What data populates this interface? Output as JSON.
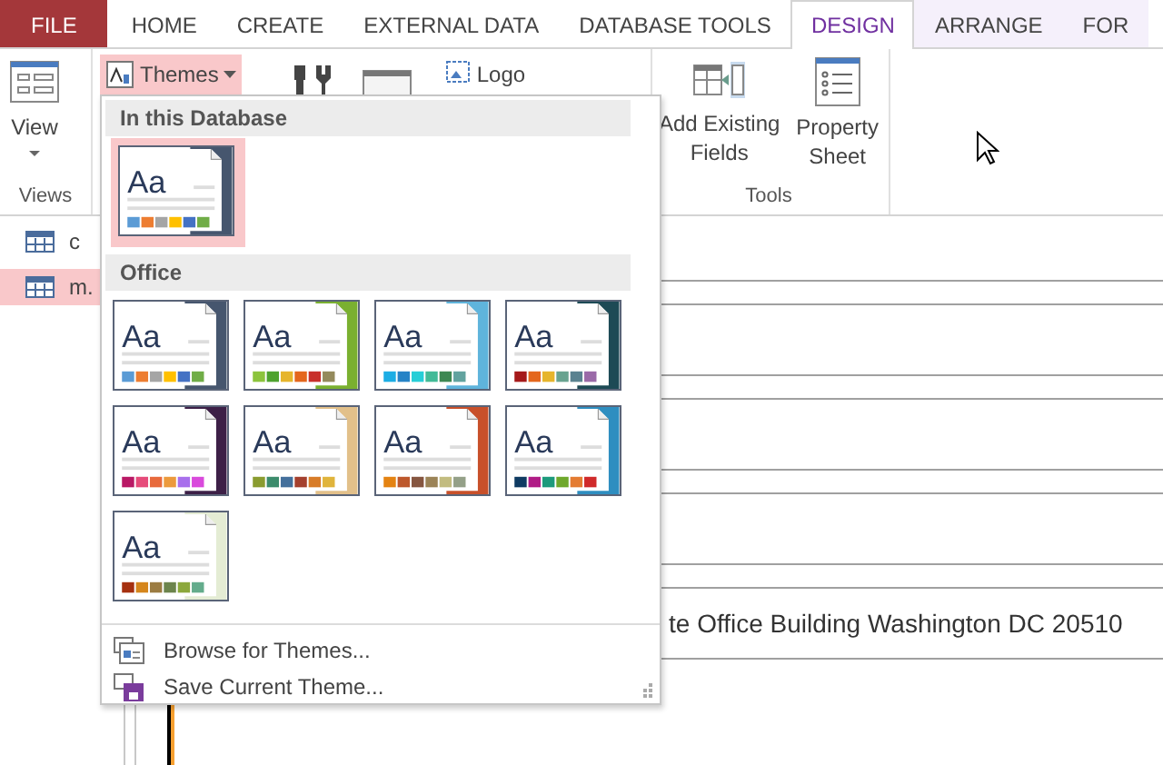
{
  "ribbon_tabs": [
    {
      "label": "FILE",
      "kind": "file",
      "selected": false
    },
    {
      "label": "HOME",
      "kind": "tab",
      "selected": false
    },
    {
      "label": "CREATE",
      "kind": "tab",
      "selected": false
    },
    {
      "label": "EXTERNAL DATA",
      "kind": "tab",
      "selected": false
    },
    {
      "label": "DATABASE TOOLS",
      "kind": "tab",
      "selected": false
    },
    {
      "label": "DESIGN",
      "kind": "context",
      "selected": true
    },
    {
      "label": "ARRANGE",
      "kind": "context",
      "selected": false
    },
    {
      "label": "FOR",
      "kind": "context",
      "selected": false
    }
  ],
  "views_group": {
    "button": "View",
    "label": "Views"
  },
  "themes_group": {
    "button": "Themes",
    "logo": "Logo"
  },
  "tools_group": {
    "buttons": [
      "Add Existing Fields",
      "Property Sheet"
    ],
    "label": "Tools"
  },
  "navigation": [
    {
      "label": "c",
      "selected": false
    },
    {
      "label": "m.",
      "selected": true
    }
  ],
  "address_field": {
    "value": "te Office Building Washington DC 20510"
  },
  "themes_menu": {
    "sections": [
      {
        "title": "In this Database",
        "themes": [
          {
            "sample": "Aa",
            "selected": true,
            "color": "#46566e",
            "swatches": [
              {
                "color": "#5b9bd5"
              },
              {
                "color": "#ed7d31"
              },
              {
                "color": "#a5a5a5"
              },
              {
                "color": "#ffc000"
              },
              {
                "color": "#4472c4"
              },
              {
                "color": "#70ad47"
              }
            ]
          }
        ]
      },
      {
        "title": "Office",
        "themes": [
          {
            "sample": "Aa",
            "selected": false,
            "color": "#46566e",
            "swatches": [
              {
                "color": "#5b9bd5"
              },
              {
                "color": "#ed7d31"
              },
              {
                "color": "#a5a5a5"
              },
              {
                "color": "#ffc000"
              },
              {
                "color": "#4472c4"
              },
              {
                "color": "#70ad47"
              }
            ]
          },
          {
            "sample": "Aa",
            "selected": false,
            "color": "#7ab030",
            "swatches": [
              {
                "color": "#8cc43c"
              },
              {
                "color": "#4ea22e"
              },
              {
                "color": "#e6b52c"
              },
              {
                "color": "#e4661c"
              },
              {
                "color": "#c8302a"
              },
              {
                "color": "#948a5c"
              }
            ]
          },
          {
            "sample": "Aa",
            "selected": false,
            "color": "#5fb4dc",
            "swatches": [
              {
                "color": "#1cade4"
              },
              {
                "color": "#2683c6"
              },
              {
                "color": "#27ced7"
              },
              {
                "color": "#42ba97"
              },
              {
                "color": "#3e8853"
              },
              {
                "color": "#62a39f"
              }
            ]
          },
          {
            "sample": "Aa",
            "selected": false,
            "color": "#1d4a55",
            "swatches": [
              {
                "color": "#a5191a"
              },
              {
                "color": "#e4661c"
              },
              {
                "color": "#e6b52c"
              },
              {
                "color": "#68a390"
              },
              {
                "color": "#5a8290"
              },
              {
                "color": "#9a6aa8"
              }
            ]
          },
          {
            "sample": "Aa",
            "selected": false,
            "color": "#3d2047",
            "swatches": [
              {
                "color": "#b91865"
              },
              {
                "color": "#e64b7a"
              },
              {
                "color": "#e86a3c"
              },
              {
                "color": "#ec9a3c"
              },
              {
                "color": "#a870ec"
              },
              {
                "color": "#d94adc"
              }
            ]
          },
          {
            "sample": "Aa",
            "selected": false,
            "color": "#e2c08a",
            "swatches": [
              {
                "color": "#8a9c30"
              },
              {
                "color": "#3c8c6c"
              },
              {
                "color": "#44709c"
              },
              {
                "color": "#a4402e"
              },
              {
                "color": "#d87c28"
              },
              {
                "color": "#e0b43c"
              }
            ]
          },
          {
            "sample": "Aa",
            "selected": false,
            "color": "#c8502a",
            "swatches": [
              {
                "color": "#e48312"
              },
              {
                "color": "#bd582c"
              },
              {
                "color": "#865640"
              },
              {
                "color": "#9b8357"
              },
              {
                "color": "#c2bc80"
              },
              {
                "color": "#94a088"
              }
            ]
          },
          {
            "sample": "Aa",
            "selected": false,
            "color": "#2e8ec0",
            "swatches": [
              {
                "color": "#0f3b62"
              },
              {
                "color": "#b01c86"
              },
              {
                "color": "#1d9a7c"
              },
              {
                "color": "#6fa82c"
              },
              {
                "color": "#e47c32"
              },
              {
                "color": "#d02a2a"
              }
            ]
          },
          {
            "sample": "Aa",
            "selected": false,
            "color": "#e4ecd4",
            "swatches": [
              {
                "color": "#a5300f"
              },
              {
                "color": "#d5861c"
              },
              {
                "color": "#9c7c42"
              },
              {
                "color": "#6c844c"
              },
              {
                "color": "#8ca83c"
              },
              {
                "color": "#64ac8c"
              }
            ]
          }
        ]
      }
    ],
    "actions": [
      {
        "label": "Browse for Themes...",
        "kind": "browse"
      },
      {
        "label": "Save Current Theme...",
        "kind": "save"
      }
    ]
  }
}
